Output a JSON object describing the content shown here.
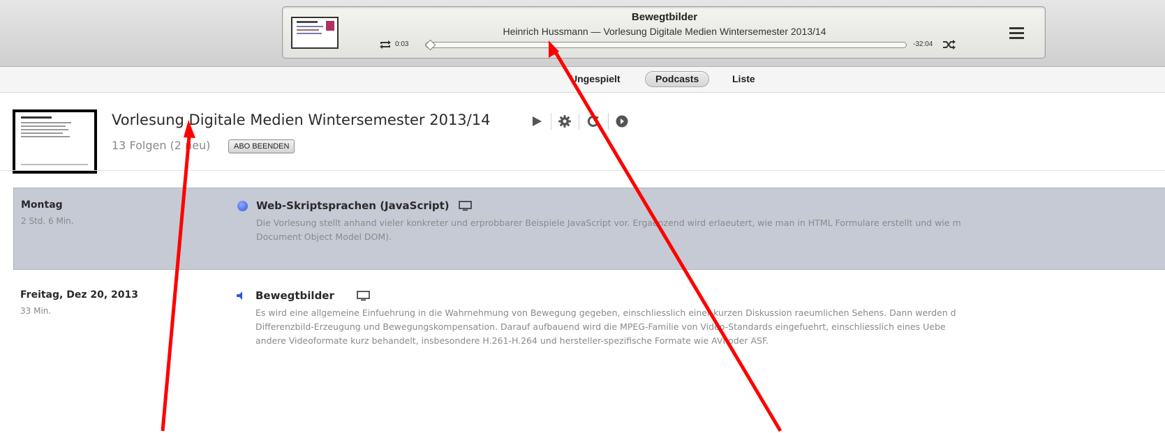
{
  "player": {
    "title": "Bewegtbilder",
    "subtitle": "Heinrich Hussmann — Vorlesung Digitale Medien Wintersemester 2013/14",
    "elapsed": "0:03",
    "remaining": "-32:04",
    "progress_fraction": 0.0016,
    "icons": {
      "repeat": "repeat-icon",
      "shuffle": "shuffle-icon",
      "menu": "list-menu-icon",
      "artwork": "slide-thumbnail"
    }
  },
  "tabs": {
    "unplayed": "Ungespielt",
    "podcasts": "Podcasts",
    "list": "Liste",
    "active": "Podcasts"
  },
  "podcast": {
    "title": "Vorlesung Digitale Medien Wintersemester 2013/14",
    "episode_count": "13 Folgen (2 neu)",
    "unsubscribe_label": "ABO BEENDEN",
    "icons": [
      "play-icon",
      "gear-icon",
      "refresh-icon",
      "arrow-right-circle-icon"
    ]
  },
  "episodes": [
    {
      "day": "Montag",
      "duration": "2 Std. 6 Min.",
      "title": "Web-Skriptsprachen (JavaScript)",
      "status_icon": "new-episode-dot-icon",
      "media_icon": "video-screen-icon",
      "selected": true,
      "description": [
        "Die Vorlesung stellt anhand vieler konkreter und erprobbarer Beispiele JavaScript vor. Ergaenzend wird erlaeutert, wie man in HTML Formulare erstellt und wie m",
        "Document Object Model DOM)."
      ]
    },
    {
      "day": "Freitag, Dez 20, 2013",
      "duration": "33 Min.",
      "title": "Bewegtbilder",
      "status_icon": "speaker-icon",
      "media_icon": "video-screen-icon",
      "selected": false,
      "description": [
        "Es wird eine allgemeine Einfuehrung in die Wahrnehmung von Bewegung gegeben, einschliesslich einer kurzen Diskussion raeumlichen Sehens. Dann werden d",
        "Differenzbild-Erzeugung und Bewegungskompensation. Darauf aufbauend wird die MPEG-Familie von Video-Standards eingefuehrt, einschliesslich eines Uebe",
        "andere Videoformate kurz behandelt, insbesondere H.261-H.264 und hersteller-spezifische Formate wie AVI oder ASF."
      ]
    }
  ],
  "colors": {
    "selected_row": "#c5cad4",
    "annotation_arrow": "#ff0000",
    "new_dot": "#3058d8"
  }
}
